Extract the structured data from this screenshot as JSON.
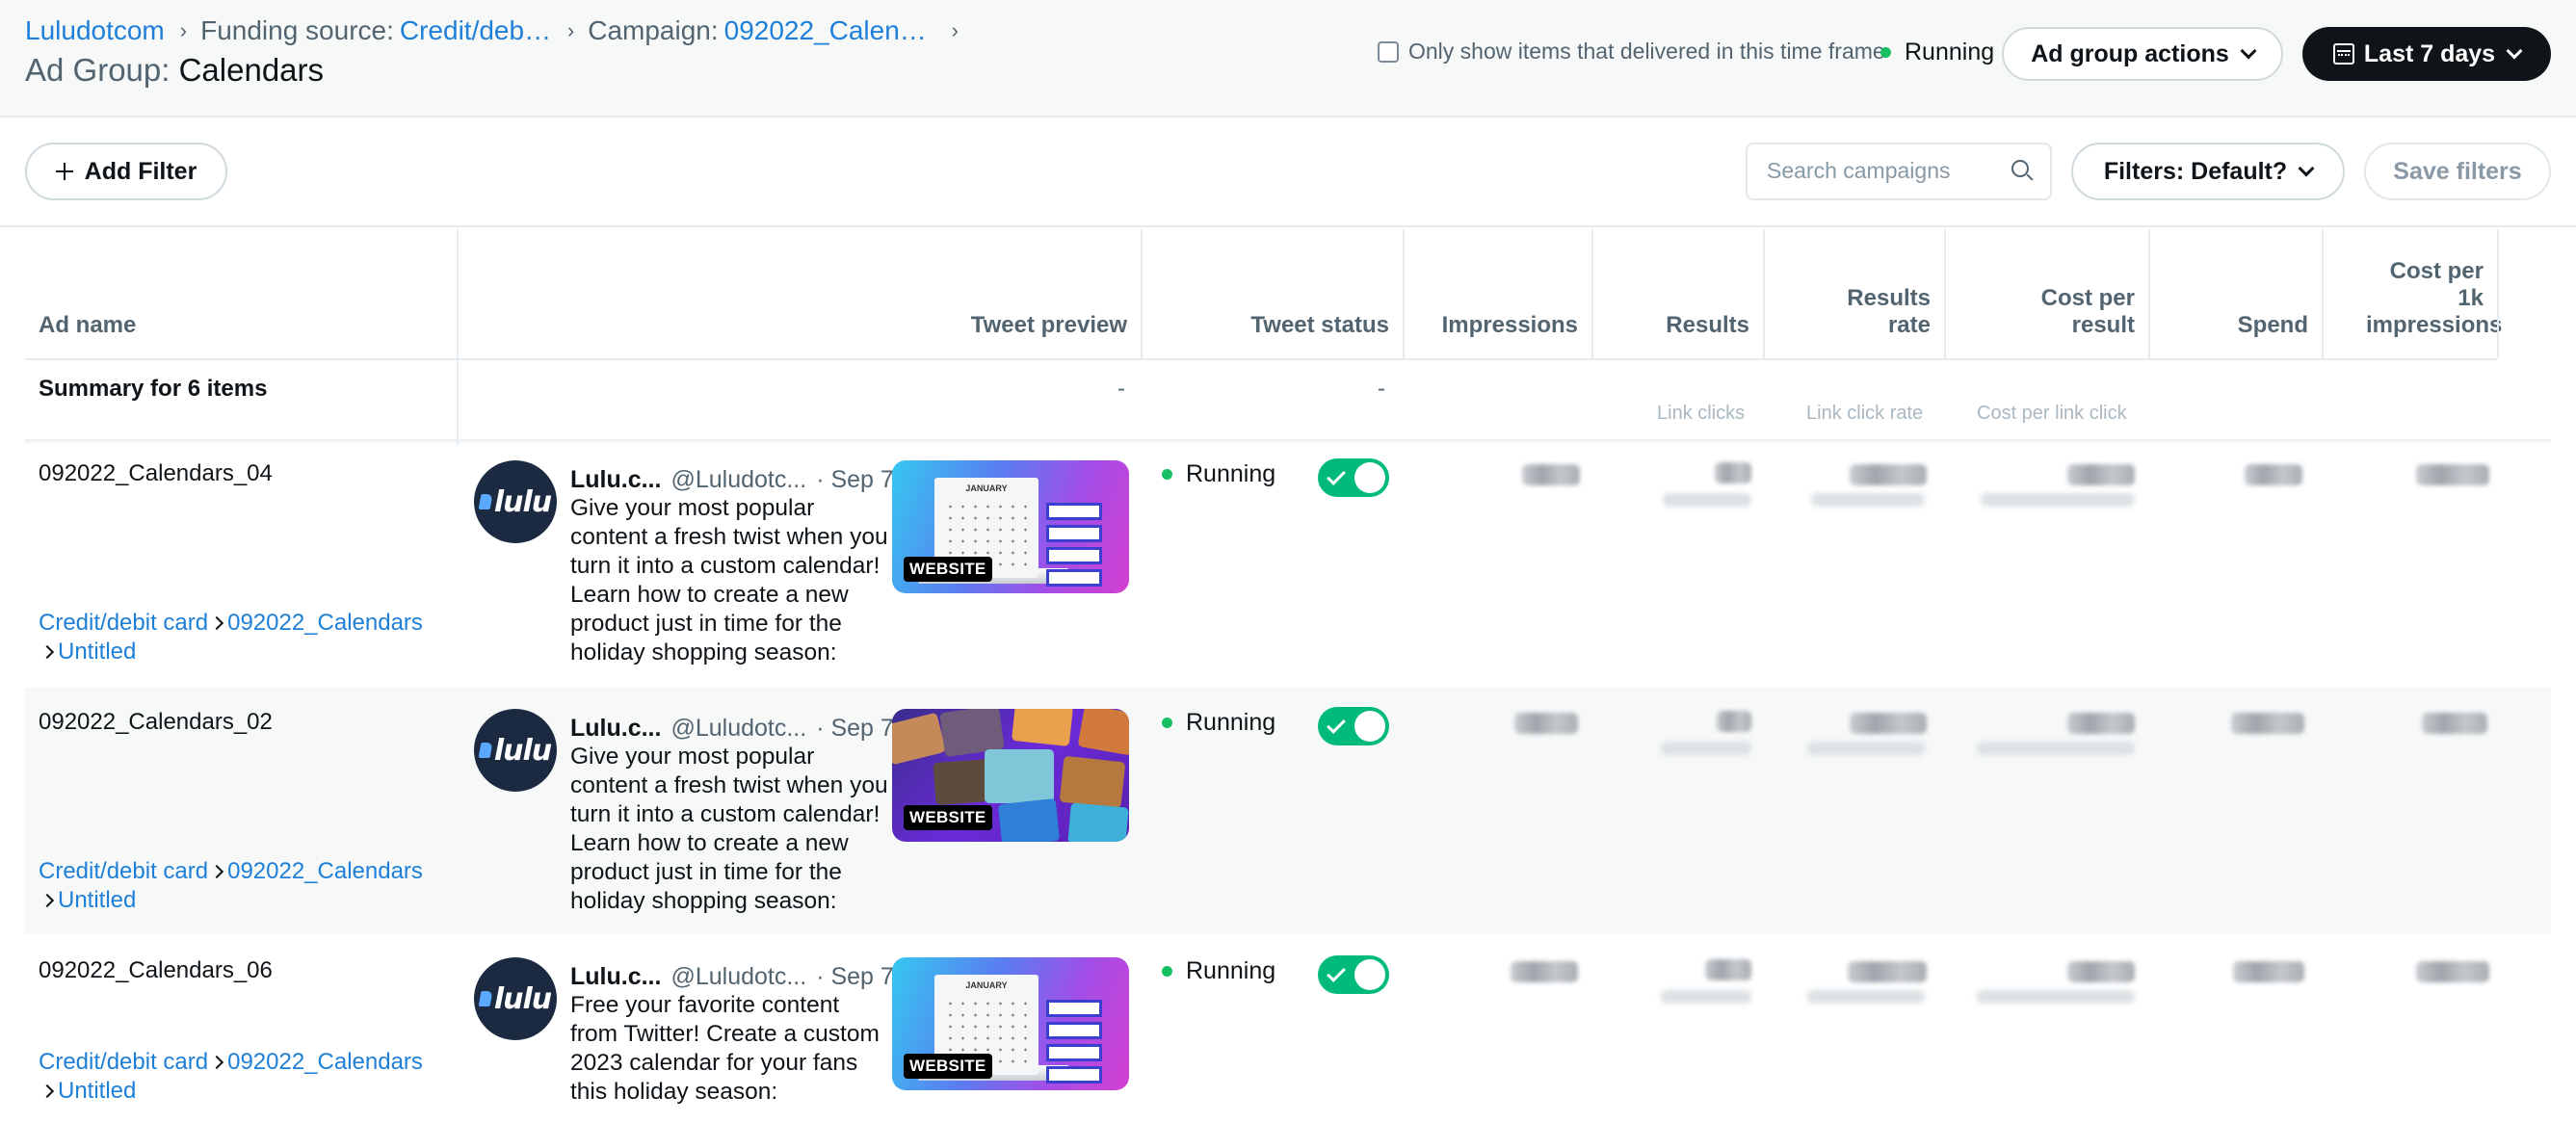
{
  "breadcrumb": {
    "root": "Luludotcom",
    "funding_label": "Funding source:",
    "funding_value": "Credit/debi...",
    "campaign_label": "Campaign:",
    "campaign_value": "092022_Calend..."
  },
  "page_title": {
    "label": "Ad Group:",
    "value": "Calendars"
  },
  "header": {
    "delivered_checkbox_label": "Only show items that delivered in this time frame",
    "status": "Running",
    "ad_group_actions": "Ad group actions",
    "date_range": "Last 7 days"
  },
  "toolbar": {
    "add_filter": "Add Filter",
    "search_placeholder": "Search campaigns",
    "filters": "Filters: Default?",
    "save_filters": "Save filters"
  },
  "table": {
    "columns": {
      "ad_name": "Ad name",
      "tweet_preview": "Tweet preview",
      "tweet_status": "Tweet status",
      "impressions": "Impressions",
      "results": "Results",
      "results_rate": "Results rate",
      "cost_per_result": "Cost per result",
      "spend": "Spend",
      "cost_per_1k": "Cost per 1k impressions"
    },
    "summary": {
      "label": "Summary for 6 items",
      "tweet_preview": "-",
      "tweet_status": "-",
      "results_sub": "Link clicks",
      "results_rate_sub": "Link click rate",
      "cost_per_result_sub": "Cost per link click"
    },
    "rows": [
      {
        "name": "092022_Calendars_04",
        "path_funding": "Credit/debit card",
        "path_campaign": "092022_Calendars",
        "path_adgroup": "Untitled",
        "tweet_author": "Lulu.c...",
        "tweet_handle": "@Luludotc...",
        "tweet_date": "· Sep 7",
        "tweet_text": "Give your most popular content a fresh twist when you turn it into a custom calendar! Learn how to create a new product just in time for the holiday shopping season:",
        "card_badge": "WEBSITE",
        "status": "Running"
      },
      {
        "name": "092022_Calendars_02",
        "path_funding": "Credit/debit card",
        "path_campaign": "092022_Calendars",
        "path_adgroup": "Untitled",
        "tweet_author": "Lulu.c...",
        "tweet_handle": "@Luludotc...",
        "tweet_date": "· Sep 7",
        "tweet_text": "Give your most popular content a fresh twist when you turn it into a custom calendar! Learn how to create a new product just in time for the holiday shopping season:",
        "card_badge": "WEBSITE",
        "status": "Running"
      },
      {
        "name": "092022_Calendars_06",
        "path_funding": "Credit/debit card",
        "path_campaign": "092022_Calendars",
        "path_adgroup": "Untitled",
        "tweet_author": "Lulu.c...",
        "tweet_handle": "@Luludotc...",
        "tweet_date": "· Sep 7",
        "tweet_text": "Free your favorite content from Twitter! Create a custom 2023 calendar for your fans this holiday season:",
        "card_badge": "WEBSITE",
        "status": "Running"
      }
    ]
  },
  "avatar_text": "lulu",
  "card_calendar_month": "JANUARY",
  "colors": {
    "link": "#1d7fd8",
    "running_dot": "#17bf63",
    "toggle_on": "#00ba7c",
    "dark_button": "#0f1419"
  }
}
